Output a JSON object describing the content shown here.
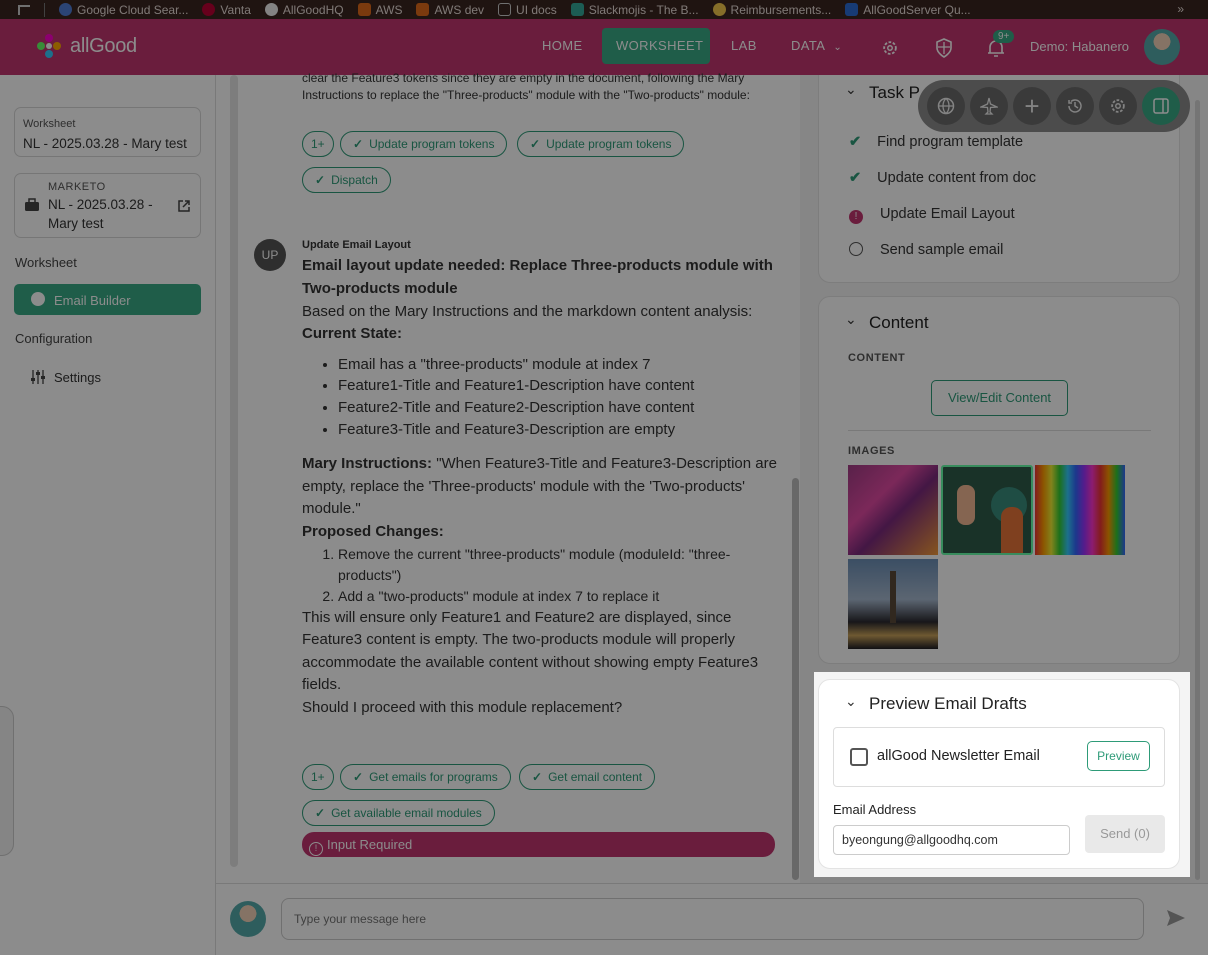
{
  "bookmarks": [
    "Google Cloud Sear...",
    "Vanta",
    "AllGoodHQ",
    "AWS",
    "AWS dev",
    "UI docs",
    "Slackmojis - The B...",
    "Reimbursements...",
    "AllGoodServer Qu..."
  ],
  "header": {
    "logo_text": "allGood",
    "nav": [
      "HOME",
      "WORKSHEET",
      "LAB",
      "DATA"
    ],
    "notification_count": "9+",
    "user_name": "Demo: Habanero"
  },
  "sidebar": {
    "worksheet_label": "Worksheet",
    "worksheet_value": "NL - 2025.03.28 - Mary test",
    "marketo_label": "MARKETO",
    "marketo_value": "NL - 2025.03.28 - Mary test",
    "section_worksheet": "Worksheet",
    "email_builder": "Email Builder",
    "section_configuration": "Configuration",
    "settings": "Settings"
  },
  "chat": {
    "prev_text": "clear the Feature3 tokens since they are empty in the document, following the Mary Instructions to replace the \"Three-products\" module with the \"Two-products\" module:",
    "prev_chips": [
      "1+",
      "Update program tokens",
      "Update program tokens",
      "Dispatch"
    ],
    "avatar_initials": "UP",
    "step_title": "Update Email Layout",
    "heading": "Email layout update needed: Replace Three-products module with Two-products module",
    "intro": "Based on the Mary Instructions and the markdown content analysis:",
    "current_state_label": "Current State:",
    "current_state": [
      "Email has a \"three-products\" module at index 7",
      "Feature1-Title and Feature1-Description have content",
      "Feature2-Title and Feature2-Description have content",
      "Feature3-Title and Feature3-Description are empty"
    ],
    "mary_label": "Mary Instructions:",
    "mary_text": "\"When Feature3-Title and Feature3-Description are empty, replace the 'Three-products' module with the 'Two-products' module.\"",
    "proposed_label": "Proposed Changes:",
    "proposed": [
      "Remove the current \"three-products\" module (moduleId: \"three-products\")",
      "Add a \"two-products\" module at index 7 to replace it"
    ],
    "conclusion": "This will ensure only Feature1 and Feature2 are displayed, since Feature3 content is empty. The two-products module will properly accommodate the available content without showing empty Feature3 fields.",
    "question": "Should I proceed with this module replacement?",
    "chips": [
      "1+",
      "Get emails for programs",
      "Get email content",
      "Get available email modules"
    ],
    "input_required": "Input Required"
  },
  "task_panel": {
    "title": "Task P",
    "items": [
      {
        "label": "Find program template",
        "status": "done"
      },
      {
        "label": "Update content from doc",
        "status": "done"
      },
      {
        "label": "Update Email Layout",
        "status": "attention"
      },
      {
        "label": "Send sample email",
        "status": "pending"
      }
    ]
  },
  "content_panel": {
    "title": "Content",
    "content_label": "CONTENT",
    "view_edit": "View/Edit Content",
    "images_label": "IMAGES"
  },
  "preview_panel": {
    "title": "Preview Email Drafts",
    "draft_name": "allGood Newsletter Email",
    "preview_button": "Preview",
    "email_label": "Email Address",
    "email_value": "byeongung@allgoodhq.com",
    "send_button": "Send (0)"
  },
  "composer": {
    "placeholder": "Type your message here"
  },
  "colors": {
    "brand": "#c2366f",
    "accent": "#3aa986",
    "header_bg": "#3a2520"
  }
}
